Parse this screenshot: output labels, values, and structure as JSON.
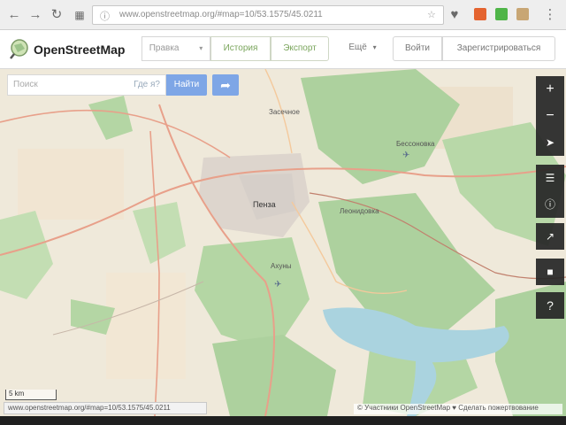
{
  "browser": {
    "back_icon": "arrow-left-icon",
    "forward_icon": "arrow-right-icon",
    "reload_icon": "reload-icon",
    "apps_icon": "apps-grid-icon",
    "url": "www.openstreetmap.org/#map=10/53.1575/45.0211"
  },
  "header": {
    "logo_text": "OpenStreetMap",
    "edit_label": "Правка",
    "history_label": "История",
    "export_label": "Экспорт",
    "more_label": "Ещё",
    "login_label": "Войти",
    "signup_label": "Зарегистрироваться"
  },
  "search": {
    "placeholder": "Поиск",
    "where_label": "Где я?",
    "go_label": "Найти"
  },
  "map": {
    "labels": {
      "city": "Пенза",
      "northwest": "Засечное",
      "northeast": "Бессоновка",
      "east": "Леонидовка",
      "south": "Ахуны"
    },
    "scale_label": "5 km",
    "attribution": "© Участники OpenStreetMap ♥ Сделать пожертвование",
    "status_url": "www.openstreetmap.org/#map=10/53.1575/45.0211"
  },
  "controls": [
    "zoom-in-icon",
    "zoom-out-icon",
    "locate-icon",
    "layers-icon",
    "info-icon",
    "share-icon",
    "note-icon",
    "help-icon"
  ],
  "colors": {
    "forest": "#add19e",
    "water": "#aad3df",
    "residential": "#e0dfdf",
    "accent_blue": "#7ea6e6",
    "accent_green": "#7aa55c"
  }
}
